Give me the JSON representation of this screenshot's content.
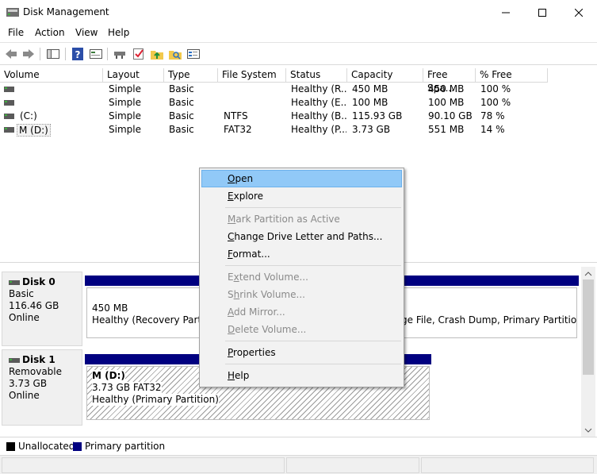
{
  "window": {
    "title": "Disk Management",
    "controls": [
      "minimize",
      "maximize",
      "close"
    ]
  },
  "menubar": [
    "File",
    "Action",
    "View",
    "Help"
  ],
  "toolbar": {
    "icons": [
      "back-icon",
      "forward-icon",
      "console-tree-icon",
      "help-icon",
      "properties-icon",
      "connect-icon",
      "check-icon",
      "up-folder-icon",
      "search-folder-icon",
      "settings-icon"
    ]
  },
  "volume_list": {
    "columns": [
      "Volume",
      "Layout",
      "Type",
      "File System",
      "Status",
      "Capacity",
      "Free Spa...",
      "% Free"
    ],
    "rows": [
      {
        "volume": "",
        "layout": "Simple",
        "type": "Basic",
        "fs": "",
        "status": "Healthy (R...",
        "capacity": "450 MB",
        "free": "450 MB",
        "pct": "100 %"
      },
      {
        "volume": "",
        "layout": "Simple",
        "type": "Basic",
        "fs": "",
        "status": "Healthy (E...",
        "capacity": "100 MB",
        "free": "100 MB",
        "pct": "100 %"
      },
      {
        "volume": "(C:)",
        "layout": "Simple",
        "type": "Basic",
        "fs": "NTFS",
        "status": "Healthy (B...",
        "capacity": "115.93 GB",
        "free": "90.10 GB",
        "pct": "78 %"
      },
      {
        "volume": "M (D:)",
        "layout": "Simple",
        "type": "Basic",
        "fs": "FAT32",
        "status": "Healthy (P...",
        "capacity": "3.73 GB",
        "free": "551 MB",
        "pct": "14 %"
      }
    ]
  },
  "disks": [
    {
      "name": "Disk 0",
      "kind": "Basic",
      "size": "116.46 GB",
      "state": "Online",
      "partition_left": {
        "size": "450 MB",
        "status": "Healthy (Recovery Partitio"
      },
      "partition_right_status": "ge File, Crash Dump, Primary Partition)"
    },
    {
      "name": "Disk 1",
      "kind": "Removable",
      "size": "3.73 GB",
      "state": "Online",
      "partition": {
        "label": "M  (D:)",
        "detail": "3.73 GB FAT32",
        "status": "Healthy (Primary Partition)"
      }
    }
  ],
  "legend": [
    {
      "label": "Unallocated",
      "color": "#000000"
    },
    {
      "label": "Primary partition",
      "color": "#000080"
    }
  ],
  "context_menu": {
    "items": [
      {
        "label": "Open",
        "key": "O",
        "rest": "pen",
        "enabled": true,
        "highlighted": true
      },
      {
        "label": "Explore",
        "key": "E",
        "rest": "xplore",
        "enabled": true
      },
      {
        "label": "Mark Partition as Active",
        "key": "M",
        "rest": "ark Partition as Active",
        "enabled": false
      },
      {
        "label": "Change Drive Letter and Paths...",
        "key": "C",
        "rest": "hange Drive Letter and Paths...",
        "enabled": true
      },
      {
        "label": "Format...",
        "key": "F",
        "rest": "ormat...",
        "enabled": true
      },
      {
        "label": "Extend Volume...",
        "key": "x",
        "pre": "E",
        "rest": "tend Volume...",
        "enabled": false
      },
      {
        "label": "Shrink Volume...",
        "key": "h",
        "pre": "S",
        "rest": "rink Volume...",
        "enabled": false
      },
      {
        "label": "Add Mirror...",
        "key": "A",
        "rest": "dd Mirror...",
        "enabled": false
      },
      {
        "label": "Delete Volume...",
        "key": "D",
        "rest": "elete Volume...",
        "enabled": false
      },
      {
        "label": "Properties",
        "key": "P",
        "rest": "roperties",
        "enabled": true
      },
      {
        "label": "Help",
        "key": "H",
        "rest": "elp",
        "enabled": true
      }
    ]
  },
  "colors": {
    "primary_partition": "#000080",
    "menu_highlight": "#91c9f7",
    "disabled_text": "#8a8a8a"
  }
}
